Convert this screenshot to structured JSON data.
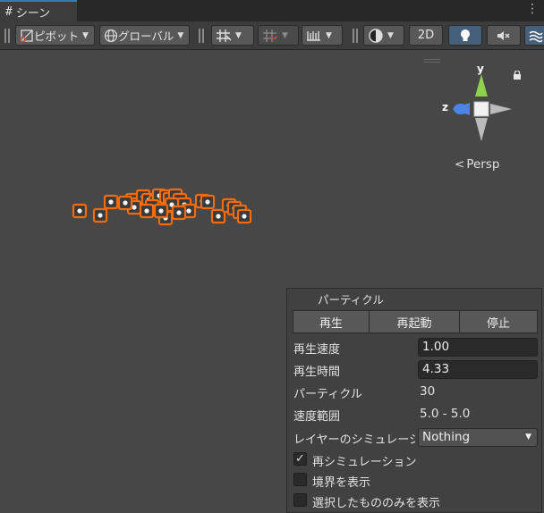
{
  "tab": {
    "icon": "#",
    "label": "シーン"
  },
  "toolbar": {
    "pivot_label": "ピボット",
    "global_label": "グローバル",
    "mode_2d": "2D"
  },
  "scene": {
    "gizmo": {
      "y": "y",
      "z": "z"
    },
    "projection": "Persp"
  },
  "panel": {
    "title": "パーティクル",
    "buttons": {
      "play": "再生",
      "restart": "再起動",
      "stop": "停止"
    },
    "playback_speed": {
      "label": "再生速度",
      "value": "1.00"
    },
    "playback_time": {
      "label": "再生時間",
      "value": "4.33"
    },
    "particles": {
      "label": "パーティクル",
      "value": "30"
    },
    "speed_range": {
      "label": "速度範囲",
      "value": "5.0 - 5.0"
    },
    "layer_sim": {
      "label": "レイヤーのシミュレーション",
      "value": "Nothing"
    },
    "resimulate": {
      "label": "再シミュレーション",
      "checked": true
    },
    "show_bounds": {
      "label": "境界を表示",
      "checked": false
    },
    "show_selected_only": {
      "label": "選択したもののみを表示",
      "checked": false
    }
  },
  "colors": {
    "selection_outline": "#f26c0d",
    "accent": "#3a79bb",
    "axis_y": "#8fd14f",
    "axis_z": "#4a86e8"
  }
}
